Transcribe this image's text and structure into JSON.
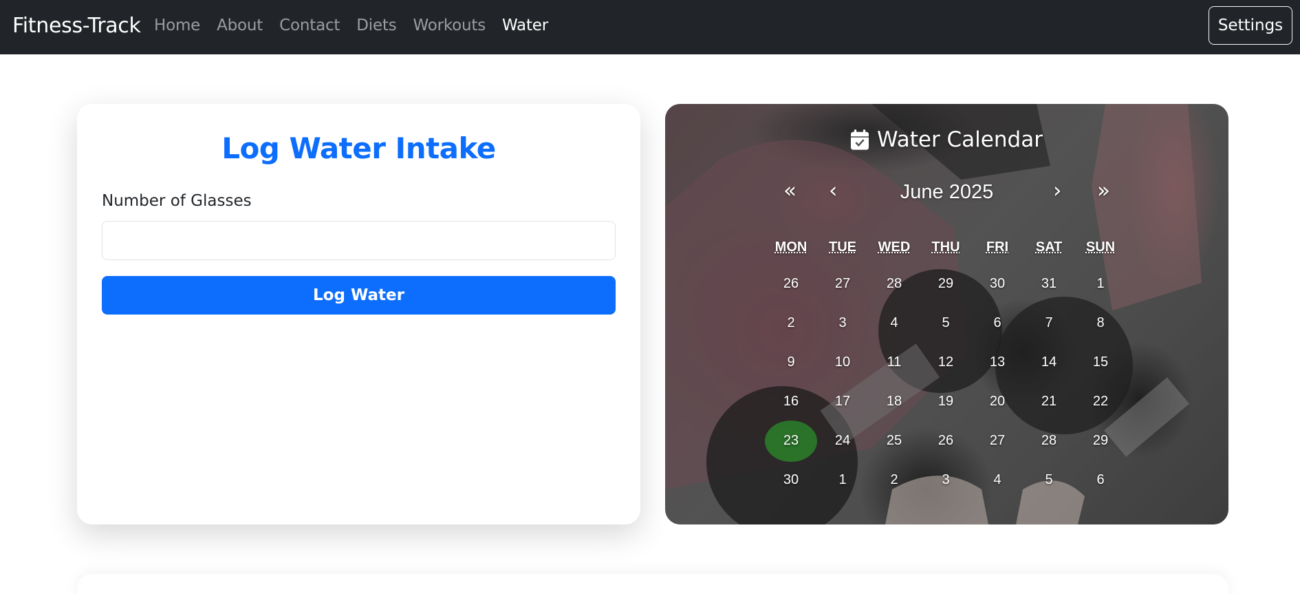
{
  "navbar": {
    "brand": "Fitness-Track",
    "items": [
      {
        "label": "Home",
        "active": false
      },
      {
        "label": "About",
        "active": false
      },
      {
        "label": "Contact",
        "active": false
      },
      {
        "label": "Diets",
        "active": false
      },
      {
        "label": "Workouts",
        "active": false
      },
      {
        "label": "Water",
        "active": true
      }
    ],
    "settings_label": "Settings"
  },
  "log_form": {
    "title": "Log Water Intake",
    "field_label": "Number of Glasses",
    "field_value": "",
    "submit_label": "Log Water"
  },
  "calendar": {
    "title": "Water Calendar",
    "icon": "calendar-check-icon",
    "nav": {
      "prev_year": "«",
      "prev_month": "‹",
      "next_month": "›",
      "next_year": "»"
    },
    "month_label": "June 2025",
    "weekdays": [
      "MON",
      "TUE",
      "WED",
      "THU",
      "FRI",
      "SAT",
      "SUN"
    ],
    "weeks": [
      [
        "26",
        "27",
        "28",
        "29",
        "30",
        "31",
        "1"
      ],
      [
        "2",
        "3",
        "4",
        "5",
        "6",
        "7",
        "8"
      ],
      [
        "9",
        "10",
        "11",
        "12",
        "13",
        "14",
        "15"
      ],
      [
        "16",
        "17",
        "18",
        "19",
        "20",
        "21",
        "22"
      ],
      [
        "23",
        "24",
        "25",
        "26",
        "27",
        "28",
        "29"
      ],
      [
        "30",
        "1",
        "2",
        "3",
        "4",
        "5",
        "6"
      ]
    ],
    "highlighted_day": "23",
    "highlight_color": "#2a8c2a"
  },
  "colors": {
    "navbar_bg": "#212529",
    "primary": "#0d6efd"
  }
}
